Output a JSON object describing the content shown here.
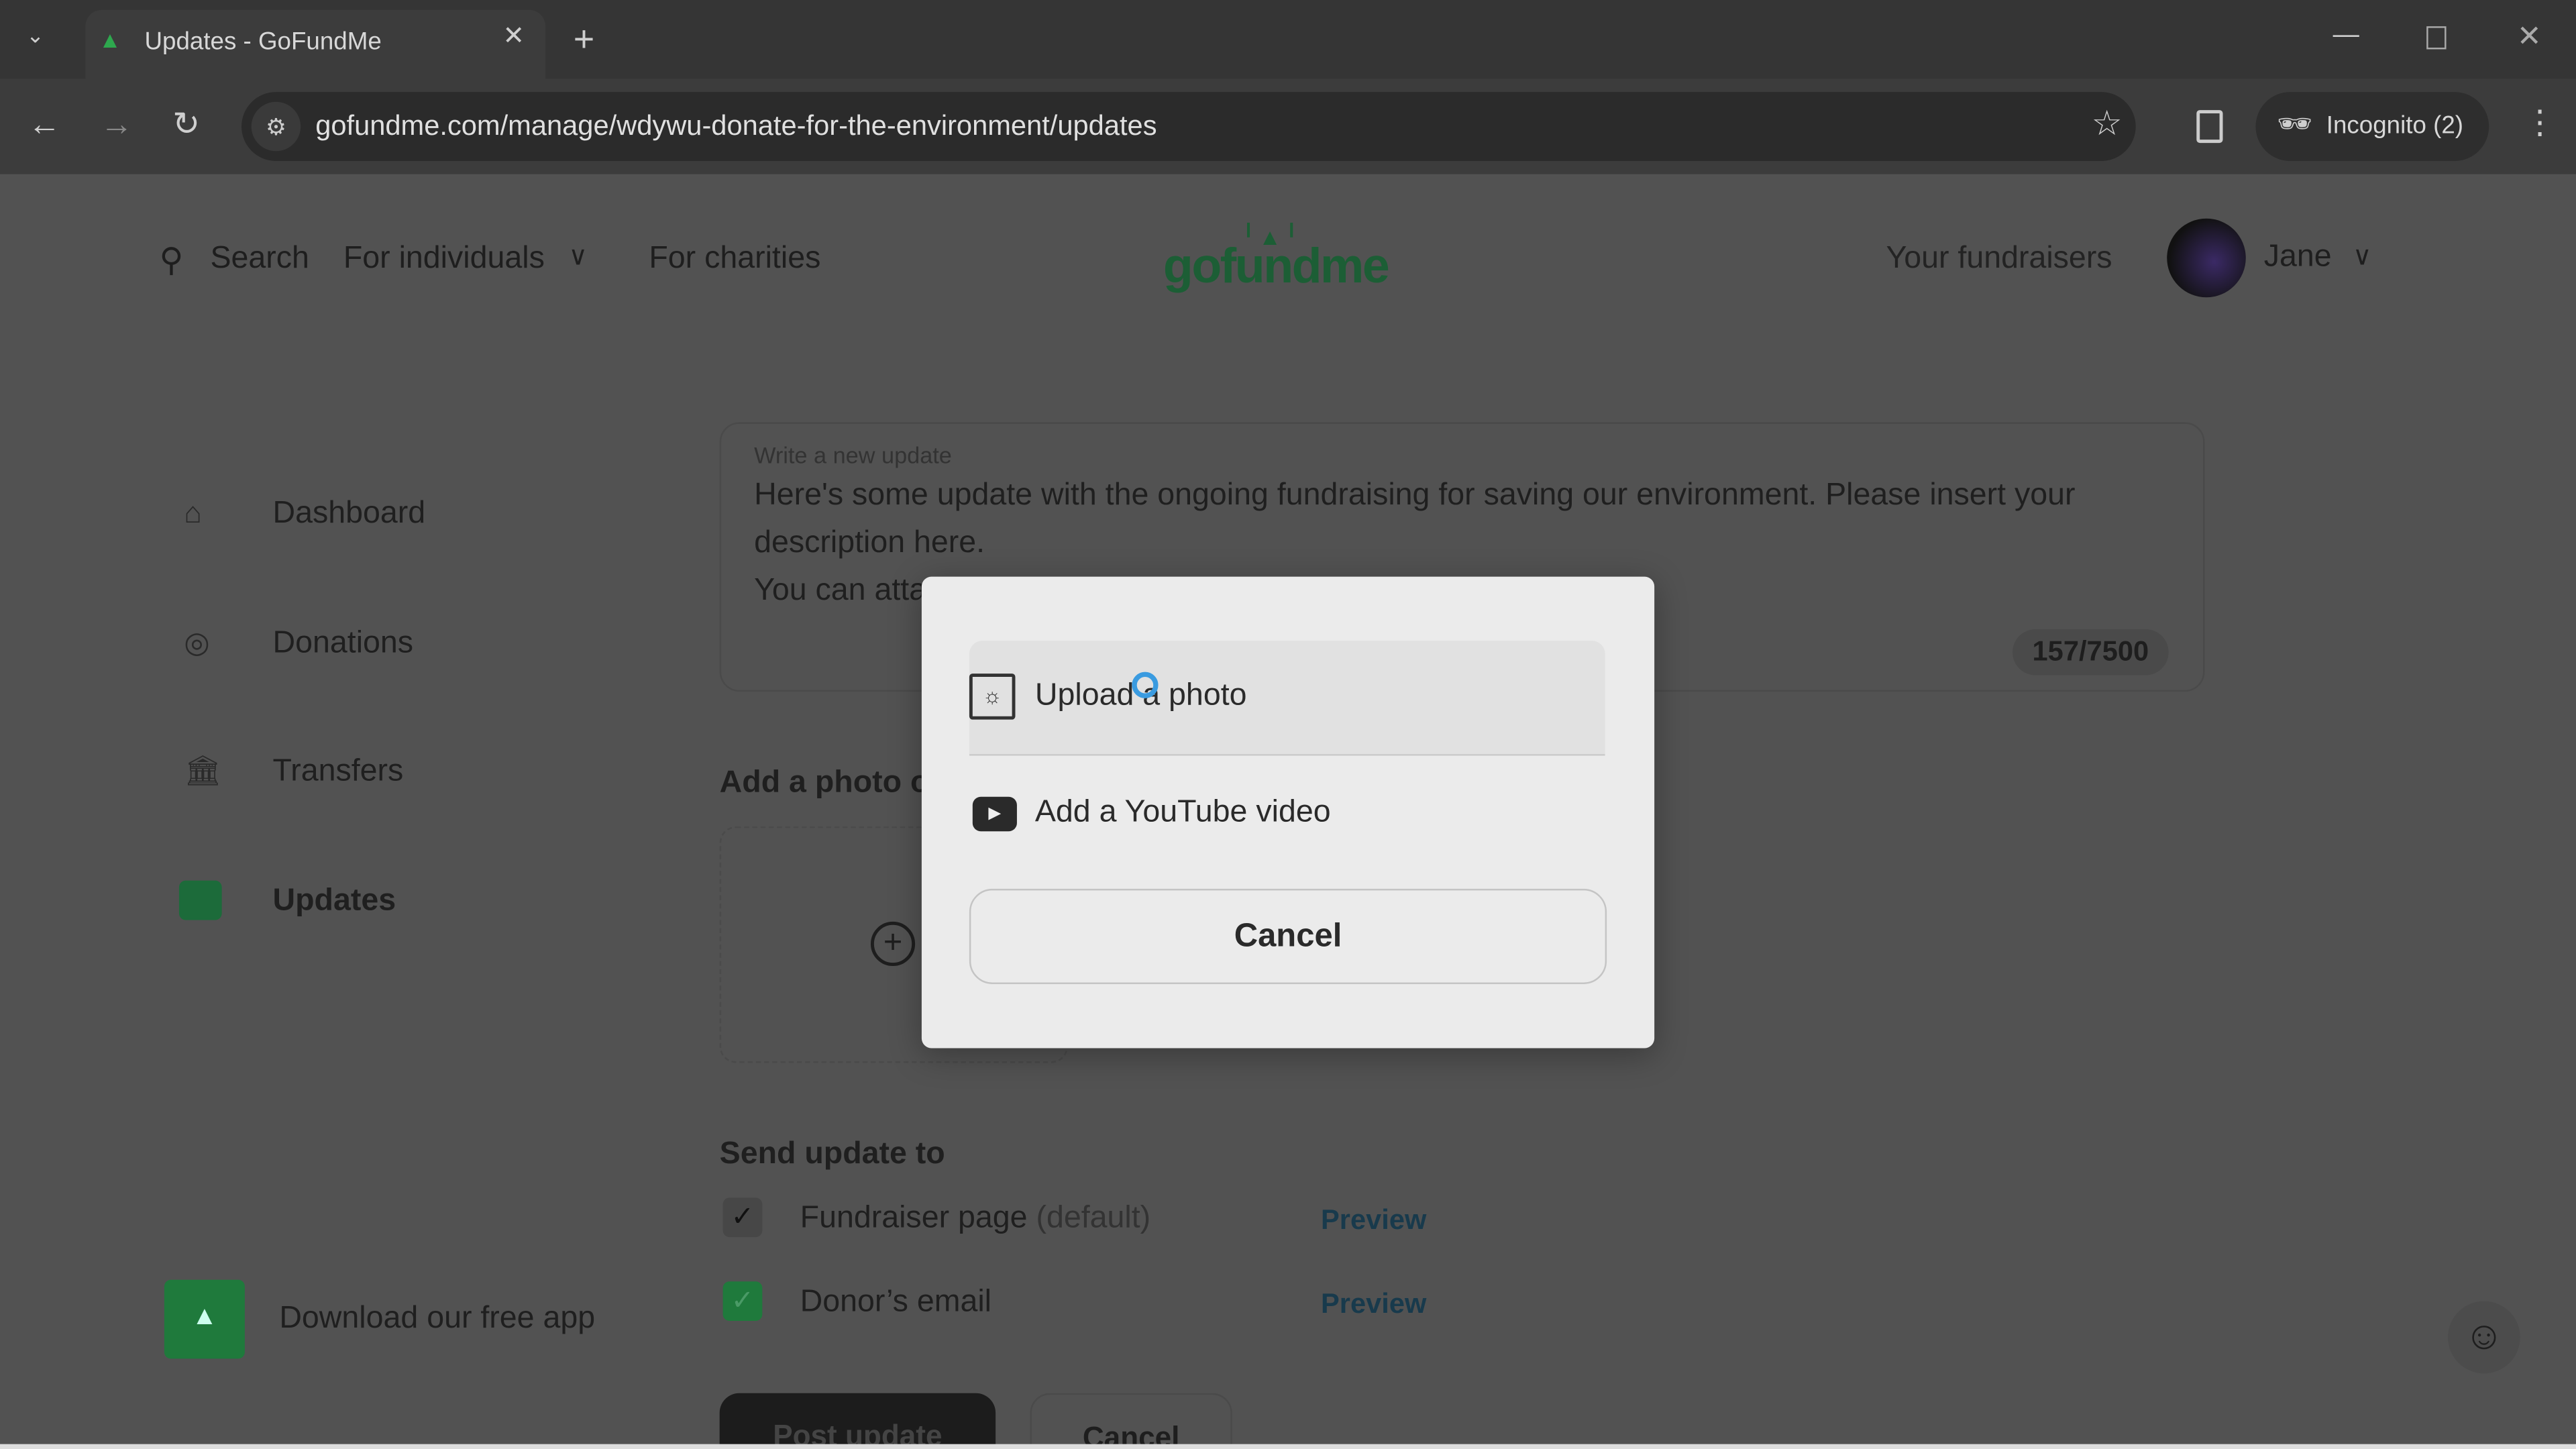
{
  "browser": {
    "tab_title": "Updates - GoFundMe",
    "url": "gofundme.com/manage/wdywu-donate-for-the-environment/updates",
    "incognito_label": "Incognito (2)"
  },
  "nav": {
    "search": "Search",
    "for_individuals": "For individuals",
    "for_charities": "For charities",
    "logo": "gofundme",
    "your_fundraisers": "Your fundraisers",
    "user": "Jane"
  },
  "sidebar": {
    "items": [
      {
        "label": "Dashboard"
      },
      {
        "label": "Donations"
      },
      {
        "label": "Transfers"
      },
      {
        "label": "Updates"
      }
    ],
    "download_app": "Download our free app"
  },
  "editor": {
    "label": "Write a new update",
    "lines": [
      "Here's some update with the ongoing fundraising for saving our environment. Please insert your",
      "description here.",
      "You can atta"
    ],
    "counter": "157/7500"
  },
  "media": {
    "heading": "Add a photo o"
  },
  "send": {
    "heading": "Send update to",
    "options": [
      {
        "label": "Fundraiser page",
        "suffix": "(default)",
        "checked": true,
        "preview": "Preview"
      },
      {
        "label": "Donor’s email",
        "checked": true,
        "preview": "Preview"
      }
    ]
  },
  "actions": {
    "post": "Post update",
    "cancel": "Cancel"
  },
  "modal": {
    "upload_photo": "Upload a photo",
    "youtube": "Add a YouTube video",
    "cancel": "Cancel"
  },
  "colors": {
    "brand_green": "#1c5e35",
    "check_green": "#1f7a3c",
    "overlay": "#525252"
  }
}
